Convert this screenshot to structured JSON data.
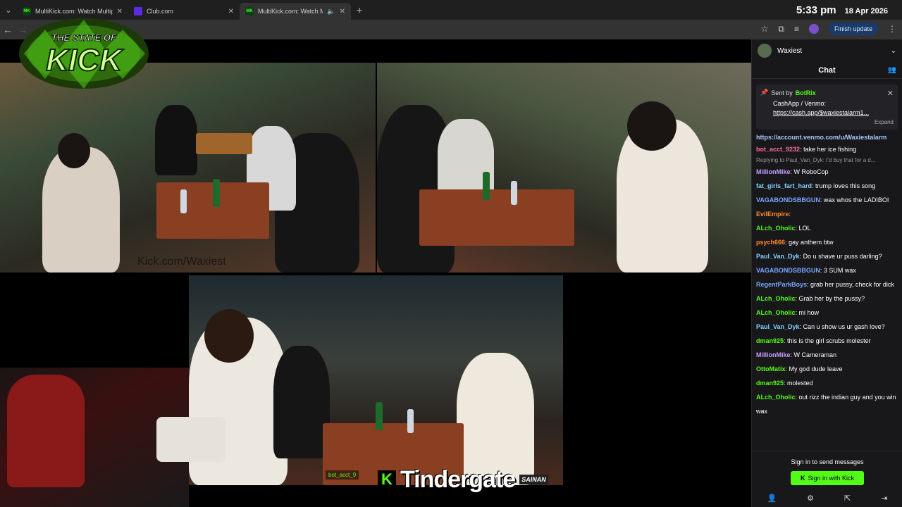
{
  "browser": {
    "tabs": [
      {
        "label": "MultiKick.com: Watch Multiple",
        "favicon": "MK"
      },
      {
        "label": "Club.com",
        "favicon": ""
      },
      {
        "label": "MultiKick.com: Watch Multi",
        "favicon": "MK"
      }
    ],
    "clock_time": "5:33 pm",
    "clock_date": "18 Apr 2026",
    "finish_update_label": "Finish update"
  },
  "overlay": {
    "logo_text_top": "THE STATE OF",
    "logo_text_main": "KICK",
    "watermark": "Kick.com/Waxiest",
    "banner_k": "K",
    "banner_text": "Tindergate",
    "banner_tag": "SAINAN",
    "overlay_chat": "bot_acct_9"
  },
  "chat": {
    "channel": "Waxiest",
    "title": "Chat",
    "pinned": {
      "sent_by": "Sent by",
      "bot": "BotRix",
      "line1": "CashApp / Venmo:",
      "line2": "https://cash.app/$waxiestalarm1...",
      "expand": "Expand"
    },
    "venmo_link": "https://account.venmo.com/u/Waxiestalarm",
    "messages": [
      {
        "user": "bot_acct_9232",
        "color": "#ff6aa8",
        "text": "take her ice fishing"
      },
      {
        "user": "MillionMike",
        "color": "#c79cff",
        "text": "W RoboCop",
        "reply": "Replying to Paul_Van_Dyk: I'd buy that for a d..."
      },
      {
        "user": "fat_girls_fart_hard",
        "color": "#7fd3ff",
        "text": "trump loves this song"
      },
      {
        "user": "VAGABONDSBBGUN",
        "color": "#7aa6ff",
        "text": "wax whos the LADIBOI"
      },
      {
        "user": "EvilEmpire",
        "color": "#ff8a2a",
        "text": ""
      },
      {
        "user": "ALch_Oholic",
        "color": "#53fc18",
        "text": "LOL"
      },
      {
        "user": "psych666",
        "color": "#ff8a2a",
        "text": "gay anthem btw"
      },
      {
        "user": "Paul_Van_Dyk",
        "color": "#7fd3ff",
        "text": "Do u shave ur puss darling?"
      },
      {
        "user": "VAGABONDSBBGUN",
        "color": "#7aa6ff",
        "text": "3 SUM wax"
      },
      {
        "user": "RegentParkBoys",
        "color": "#7aa6ff",
        "text": "grab her pussy, check for dick"
      },
      {
        "user": "ALch_Oholic",
        "color": "#53fc18",
        "text": "Grab her by the pussy?"
      },
      {
        "user": "ALch_Oholic",
        "color": "#53fc18",
        "text": "mi how"
      },
      {
        "user": "Paul_Van_Dyk",
        "color": "#7fd3ff",
        "text": "Can u show us ur gash love?"
      },
      {
        "user": "dman925",
        "color": "#53fc18",
        "text": "this is the girl scrubs molester"
      },
      {
        "user": "MillionMike",
        "color": "#c79cff",
        "text": "W Cameraman"
      },
      {
        "user": "OttoMatix",
        "color": "#53fc18",
        "text": "My god dude leave"
      },
      {
        "user": "dman925",
        "color": "#53fc18",
        "text": "molested"
      },
      {
        "user": "ALch_Oholic",
        "color": "#53fc18",
        "text": "out rizz the indian guy and you win wax"
      }
    ],
    "signin_prompt": "Sign in to send messages",
    "signin_button": "Sign in with Kick"
  }
}
